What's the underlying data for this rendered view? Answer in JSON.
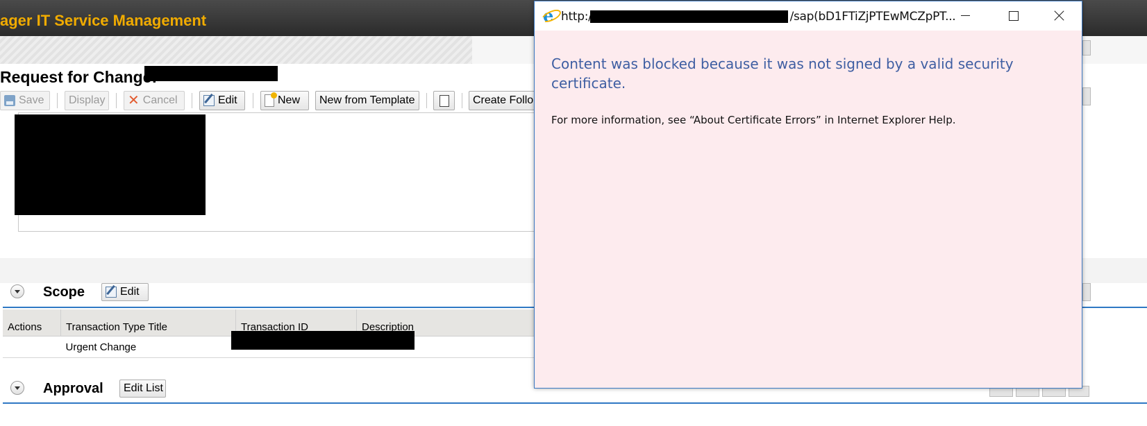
{
  "app": {
    "title": "ager IT Service Management"
  },
  "page": {
    "title": "Request for Change:"
  },
  "toolbar": {
    "save": "Save",
    "display": "Display",
    "cancel": "Cancel",
    "edit": "Edit",
    "new": "New",
    "new_from_template": "New from Template",
    "create_follow": "Create Follo"
  },
  "scope": {
    "title": "Scope",
    "edit": "Edit",
    "columns": [
      "Actions",
      "Transaction Type Title",
      "Transaction ID",
      "Description"
    ],
    "rows": [
      {
        "actions": "",
        "type_title": "Urgent Change",
        "transaction_id": "",
        "description": ""
      }
    ]
  },
  "approval": {
    "title": "Approval",
    "edit_list": "Edit List"
  },
  "popup": {
    "url_prefix": "http:/",
    "url_suffix": "/sap(bD1FTiZjPTEwMCZpPT...",
    "blocked_message": "Content was blocked because it was not signed by a valid security certificate.",
    "info_message": "For more information, see “About Certificate Errors” in Internet Explorer Help."
  },
  "colors": {
    "header_bg": "#2b2b2b",
    "brand": "#f0ab00",
    "accent_line": "#2f78c4",
    "popup_bg": "#fdebee",
    "popup_text": "#3e5ea2"
  }
}
